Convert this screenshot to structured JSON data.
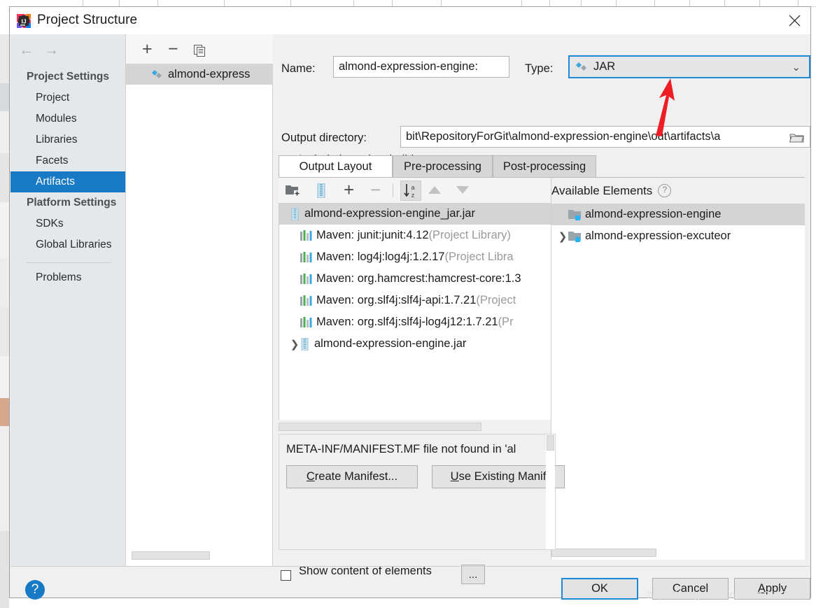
{
  "window": {
    "title": "Project Structure",
    "app_icon": "intellij-idea-icon",
    "close_icon": "close-icon"
  },
  "nav": {
    "back_icon": "arrow-left-icon",
    "forward_icon": "arrow-right-icon",
    "groups": [
      {
        "label": "Project Settings",
        "items": [
          "Project",
          "Modules",
          "Libraries",
          "Facets",
          "Artifacts"
        ],
        "selected": "Artifacts"
      },
      {
        "label": "Platform Settings",
        "items": [
          "SDKs",
          "Global Libraries"
        ]
      }
    ],
    "extra": "Problems"
  },
  "artifact_list": {
    "toolbar": {
      "add": "+",
      "remove": "−",
      "copy_icon": "copy-icon"
    },
    "items": [
      {
        "label": "almond-express",
        "icon": "artifact-diamond-icon",
        "selected": true
      }
    ]
  },
  "form": {
    "name_label": "Name:",
    "name_value": "almond-expression-engine:",
    "type_label": "Type:",
    "type_value": "JAR",
    "type_icon": "artifact-diamond-icon",
    "type_chevron": "chevron-down-icon",
    "output_dir_label": "Output directory:",
    "output_dir_value": "bit\\RepositoryForGit\\almond-expression-engine\\out\\artifacts\\a",
    "browse_icon": "folder-browse-icon",
    "include_in_build_label": "Include in project build",
    "include_in_build_mnemonic": "b",
    "include_in_build_checked": false
  },
  "tabs": [
    {
      "label": "Output Layout",
      "active": true
    },
    {
      "label": "Pre-processing",
      "active": false
    },
    {
      "label": "Post-processing",
      "active": false
    }
  ],
  "output_toolbar": [
    {
      "name": "add-directory-icon",
      "label": ""
    },
    {
      "name": "add-archive-icon",
      "label": ""
    },
    {
      "name": "add-element-icon",
      "label": "+"
    },
    {
      "name": "remove-element-icon",
      "label": "−"
    },
    {
      "name": "sort-az-icon",
      "label": "",
      "active": true
    },
    {
      "name": "move-up-icon",
      "label": ""
    },
    {
      "name": "move-down-icon",
      "label": ""
    }
  ],
  "output_tree": [
    {
      "text": "almond-expression-engine_jar.jar",
      "suffix": "",
      "icon": "jar-icon",
      "indent": 0,
      "selected": true,
      "twisty": ""
    },
    {
      "text": "Maven: junit:junit:4.12",
      "suffix": " (Project Library)",
      "icon": "library-icon",
      "indent": 1,
      "selected": false,
      "twisty": ""
    },
    {
      "text": "Maven: log4j:log4j:1.2.17",
      "suffix": " (Project Libra",
      "icon": "library-icon",
      "indent": 1,
      "selected": false,
      "twisty": ""
    },
    {
      "text": "Maven: org.hamcrest:hamcrest-core:1.3",
      "suffix": "",
      "icon": "library-icon",
      "indent": 1,
      "selected": false,
      "twisty": ""
    },
    {
      "text": "Maven: org.slf4j:slf4j-api:1.7.21",
      "suffix": " (Project",
      "icon": "library-icon",
      "indent": 1,
      "selected": false,
      "twisty": ""
    },
    {
      "text": "Maven: org.slf4j:slf4j-log4j12:1.7.21",
      "suffix": " (Pr",
      "icon": "library-icon",
      "indent": 1,
      "selected": false,
      "twisty": ""
    },
    {
      "text": "almond-expression-engine.jar",
      "suffix": "",
      "icon": "jar-icon",
      "indent": 1,
      "selected": false,
      "twisty": "❯"
    }
  ],
  "available": {
    "header": "Available Elements",
    "help_icon": "help-circle-icon",
    "items": [
      {
        "text": "almond-expression-engine",
        "icon": "module-folder-icon",
        "twisty": "",
        "selected": true
      },
      {
        "text": "almond-expression-excuteor",
        "icon": "module-folder-icon",
        "twisty": "❯",
        "selected": false
      }
    ]
  },
  "manifest": {
    "message": "META-INF/MANIFEST.MF file not found in 'al",
    "create_label": "Create Manifest...",
    "create_mnemonic": "C",
    "use_existing_label": "Use Existing Manif",
    "use_existing_mnemonic": "U"
  },
  "bottom": {
    "show_content_label": "Show content of elements",
    "show_content_checked": false,
    "ellipsis_label": "..."
  },
  "footer": {
    "help_icon": "help-icon",
    "help_glyph": "?",
    "buttons": [
      {
        "label": "OK",
        "primary": true
      },
      {
        "label": "Cancel",
        "primary": false
      },
      {
        "label": "Apply",
        "primary": false,
        "mnemonic": "A"
      }
    ]
  },
  "watermark": "https://blog.csdn.net/MACHENIC",
  "colors": {
    "accent": "#1879c4",
    "focus_border": "#1e8ad6",
    "selection": "#d4d4d4",
    "nav_bg": "#e4e8ea",
    "dialog_bg": "#f0f0f0",
    "annotation_arrow": "#ee1c25"
  }
}
